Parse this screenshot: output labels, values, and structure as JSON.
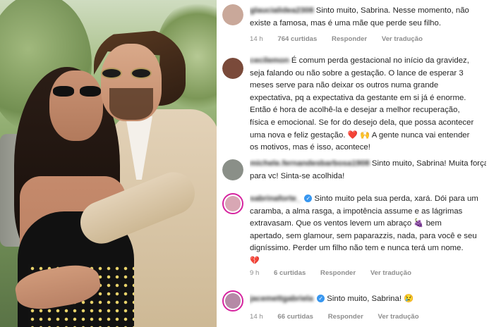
{
  "comments": [
    {
      "username": "glaucialidea2308",
      "verified": false,
      "lines": [
        "Sinto muito, Sabrina. Nesse momento, não",
        "existe a famosa, mas é uma mãe que perde seu filho."
      ],
      "time": "14 h",
      "likes": "764 curtidas",
      "reply": "Responder",
      "translate": "Ver tradução",
      "avatar_color": "#c9a89a"
    },
    {
      "username": "cecilemon",
      "verified": false,
      "lines": [
        "É comum perda gestacional no início da gravidez,",
        "seja falando ou não sobre a gestação. O lance de esperar 3",
        "meses serve para não deixar os outros numa grande",
        "expectativa, pq a expectativa da gestante em si já é enorme.",
        "Então é hora de acolhê-la e desejar a melhor recuperação,",
        "física e emocional. Se for do desejo dela, que possa acontecer",
        "uma nova e feliz gestação. ❤️ 🙌 A gente nunca vai entender",
        "os motivos, mas é isso, acontece!"
      ],
      "avatar_color": "#7a4a3a"
    },
    {
      "username": "michele.fernandesbarbosa1908",
      "verified": false,
      "lines": [
        "Sinto muito, Sabrina! Muita força",
        "para vc! Sinta-se acolhida!"
      ],
      "avatar_color": "#8a8f88"
    },
    {
      "username": "sabrinaforte_",
      "verified": true,
      "lines": [
        "Sinto muito pela sua perda, xará. Dói para um",
        "caramba, a alma rasga, a impotência assume e as lágrimas",
        "extravasam. Que os ventos levem um abraço 🍇 bem",
        "apertado, sem glamour, sem paparazzis, nada, para você e seu",
        "digníssimo. Perder um filho não tem e nunca terá um nome.",
        "💔"
      ],
      "time": "9 h",
      "likes": "6 curtidas",
      "reply": "Responder",
      "translate": "Ver tradução",
      "avatar_color": "#d8a7b4"
    },
    {
      "username": "jacemettgabriela",
      "verified": true,
      "lines": [
        "Sinto muito, Sabrina! 😢"
      ],
      "time": "14 h",
      "likes": "66 curtidas",
      "reply": "Responder",
      "translate": "Ver tradução",
      "avatar_color": "#b58aa6"
    }
  ]
}
